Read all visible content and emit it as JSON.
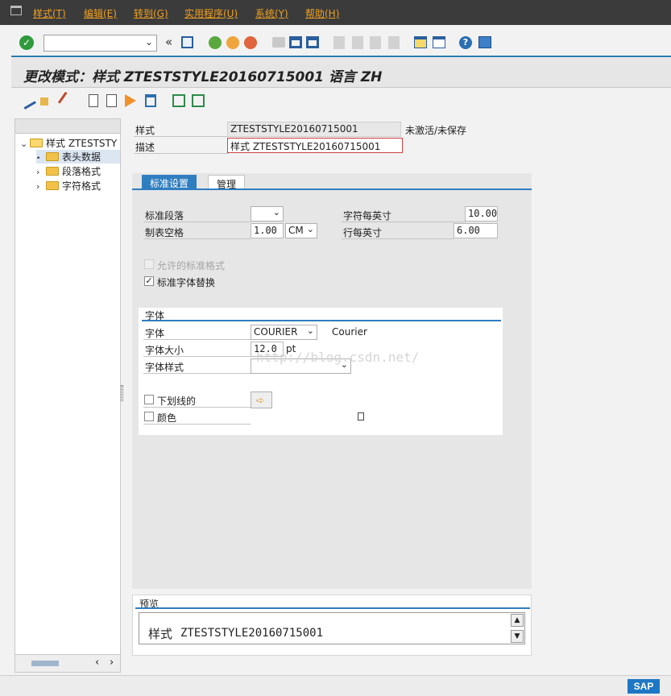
{
  "menu": {
    "items": [
      "样式(T)",
      "编辑(E)",
      "转到(G)",
      "实用程序(U)",
      "系统(Y)",
      "帮助(H)"
    ]
  },
  "toolbar": {
    "command_field_value": "",
    "icons": [
      "enter-check-icon",
      "back-arrows-icon",
      "save-icon",
      "back-icon",
      "exit-icon",
      "cancel-icon",
      "print-icon",
      "find-icon",
      "find-next-icon",
      "first-page-icon",
      "prev-page-icon",
      "next-page-icon",
      "last-page-icon",
      "new-session-icon",
      "shortcut-icon",
      "help-icon",
      "layout-icon"
    ]
  },
  "title": "更改模式：样式 ZTESTSTYLE20160715001 语言 ZH",
  "app_toolbar": {
    "icons": [
      "display-change-icon",
      "hierarchy-icon",
      "edit-pencil-icon",
      "new-document-icon",
      "copy-document-icon",
      "play-icon",
      "delete-icon",
      "insert-row-icon",
      "remove-row-icon"
    ]
  },
  "tree": {
    "root": "样式 ZTESTSTY",
    "items": [
      "表头数据",
      "段落格式",
      "字符格式"
    ]
  },
  "header": {
    "style_label": "样式",
    "style_value": "ZTESTSTYLE20160715001",
    "status": "未激活/未保存",
    "desc_label": "描述",
    "desc_value": "样式 ZTESTSTYLE20160715001"
  },
  "tabs": [
    "标准设置",
    "管理"
  ],
  "standard": {
    "para_label": "标准段落",
    "para_value": "",
    "tab_label": "制表空格",
    "tab_value": "1.00",
    "tab_unit": "CM",
    "cpi_label": "字符每英寸",
    "cpi_value": "10.00",
    "lpi_label": "行每英寸",
    "lpi_value": "6.00",
    "allowed_label": "允许的标准格式",
    "replace_label": "标准字体替换",
    "replace_checked": "✓"
  },
  "font": {
    "group_title": "字体",
    "family_label": "字体",
    "family_value": "COURIER",
    "family_desc": "Courier",
    "size_label": "字体大小",
    "size_value": "12.0",
    "size_unit": "pt",
    "style_label": "字体样式",
    "style_value": "",
    "underline_label": "下划线的",
    "color_label": "颜色"
  },
  "preview": {
    "title": "预览",
    "prefix": "样式",
    "text": "ZTESTSTYLE20160715001"
  },
  "watermark": "http://blog.csdn.net/",
  "brand": "SAP",
  "colors": {
    "menu_bg": "#3b3b3b",
    "menu_text": "#f0a020",
    "accent_blue": "#2f7ec0"
  }
}
